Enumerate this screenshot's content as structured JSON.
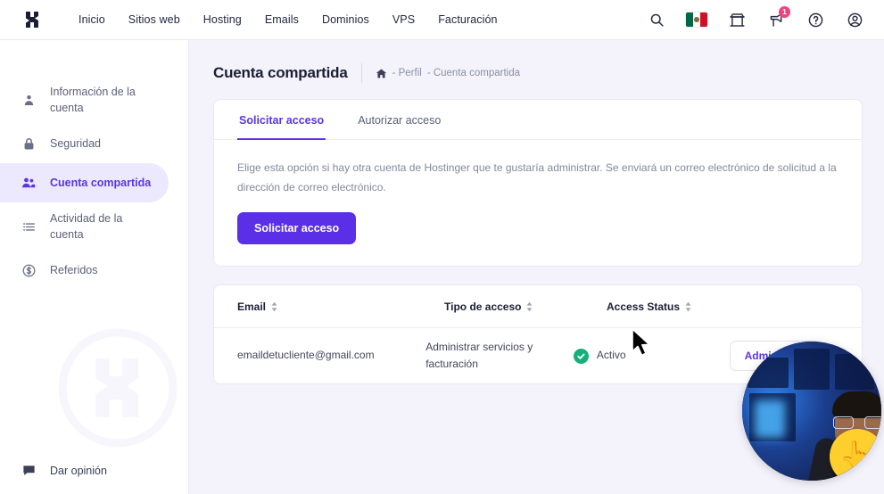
{
  "header": {
    "logo_name": "hostinger-logo",
    "nav": [
      {
        "label": "Inicio"
      },
      {
        "label": "Sitios web"
      },
      {
        "label": "Hosting"
      },
      {
        "label": "Emails"
      },
      {
        "label": "Dominios"
      },
      {
        "label": "VPS"
      },
      {
        "label": "Facturación"
      }
    ],
    "icons": {
      "search": "search-icon",
      "flag": "mexico-flag-icon",
      "market": "store-icon",
      "announcements": "megaphone-icon",
      "help": "help-circle-icon",
      "account": "user-circle-icon"
    },
    "notification_count": "1"
  },
  "sidebar": {
    "items": [
      {
        "label": "Información de la cuenta",
        "icon": "user-icon",
        "active": false
      },
      {
        "label": "Seguridad",
        "icon": "lock-icon",
        "active": false
      },
      {
        "label": "Cuenta compartida",
        "icon": "users-icon",
        "active": true
      },
      {
        "label": "Actividad de la cuenta",
        "icon": "list-icon",
        "active": false
      },
      {
        "label": "Referidos",
        "icon": "dollar-circle-icon",
        "active": false
      }
    ],
    "feedback": {
      "label": "Dar opinión",
      "icon": "chat-icon"
    }
  },
  "page": {
    "title": "Cuenta compartida",
    "breadcrumb": {
      "home_icon": "home-icon",
      "items": [
        "- Perfil",
        "- Cuenta compartida"
      ]
    }
  },
  "tabs": [
    {
      "label": "Solicitar acceso",
      "active": true
    },
    {
      "label": "Autorizar acceso",
      "active": false
    }
  ],
  "request_panel": {
    "description": "Elige esta opción si hay otra cuenta de Hostinger que te gustaría administrar. Se enviará un correo electrónico de solicitud a la dirección de correo electrónico.",
    "button_label": "Solicitar acceso"
  },
  "table": {
    "columns": [
      {
        "label": "Email",
        "sortable": true
      },
      {
        "label": "Tipo de acceso",
        "sortable": true
      },
      {
        "label": "Access Status",
        "sortable": true
      }
    ],
    "rows": [
      {
        "email": "emaildetucliente@gmail.com",
        "access_type": "Administrar servicios y facturación",
        "status": "Activo",
        "status_icon": "check-circle-icon",
        "action_label": "Administrar",
        "menu_icon": "kebab-menu-icon"
      }
    ]
  },
  "colors": {
    "brand_purple": "#5b2ee8",
    "active_purple": "#5b36e0",
    "sidebar_active_bg": "#ece8fd",
    "page_bg": "#f4f3fb",
    "status_green": "#14b07a",
    "badge_pink": "#f0427f"
  },
  "overlay": {
    "webcam_name": "webcam-overlay",
    "emoji": "👆",
    "cursor_name": "mouse-cursor"
  }
}
